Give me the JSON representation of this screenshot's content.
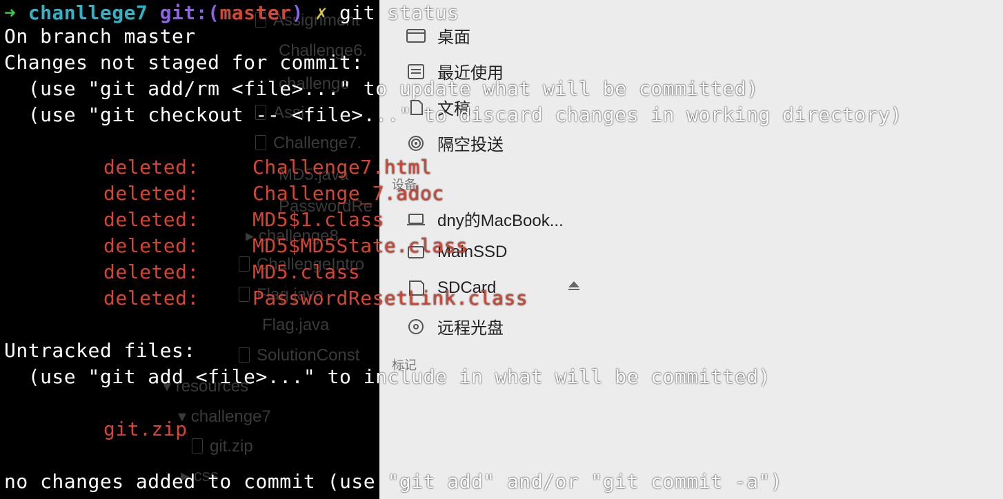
{
  "background_window": {
    "tree_items": [
      "Assignment",
      "Challenge6.",
      "challenge",
      "Assi",
      "Challenge7.",
      "MD5.java",
      "PasswordRe",
      "challenge8",
      "ChallengeIntro",
      "Flag.java",
      "Flag.java",
      "SolutionConst",
      "resources",
      "challenge7",
      "git.zip",
      "css"
    ],
    "sidebar": {
      "items_top": [
        "桌面",
        "最近使用",
        "文稿",
        "隔空投送"
      ],
      "section_devices": "设备",
      "devices": [
        "dny的MacBook...",
        "MainSSD",
        "SDCard",
        "远程光盘"
      ],
      "section_tags": "标记"
    }
  },
  "terminal": {
    "prompt": {
      "arrow": "➜",
      "dir": "chanllege7",
      "git_prefix": "git:(",
      "branch": "master",
      "git_suffix": ")",
      "dirty": "✗",
      "command": "git status"
    },
    "on_branch": "On branch master",
    "changes_header": "Changes not staged for commit:",
    "changes_hint1": "  (use \"git add/rm <file>...\" to update what will be committed)",
    "changes_hint2": "  (use \"git checkout -- <file>...\" to discard changes in working directory)",
    "deleted_label": "deleted:",
    "deleted_files": [
      "Challenge7.html",
      "Challenge_7.adoc",
      "MD5$1.class",
      "MD5$MD5State.class",
      "MD5.class",
      "PasswordResetLink.class"
    ],
    "untracked_header": "Untracked files:",
    "untracked_hint": "  (use \"git add <file>...\" to include in what will be committed)",
    "untracked_files": [
      "git.zip"
    ],
    "footer": "no changes added to commit (use \"git add\" and/or \"git commit -a\")"
  },
  "colors": {
    "prompt_arrow": "#36d13a",
    "dir": "#2fb3c7",
    "git": "#8d62e6",
    "branch": "#d64532",
    "dirty": "#d6c83c",
    "file_status": "#d64532"
  }
}
